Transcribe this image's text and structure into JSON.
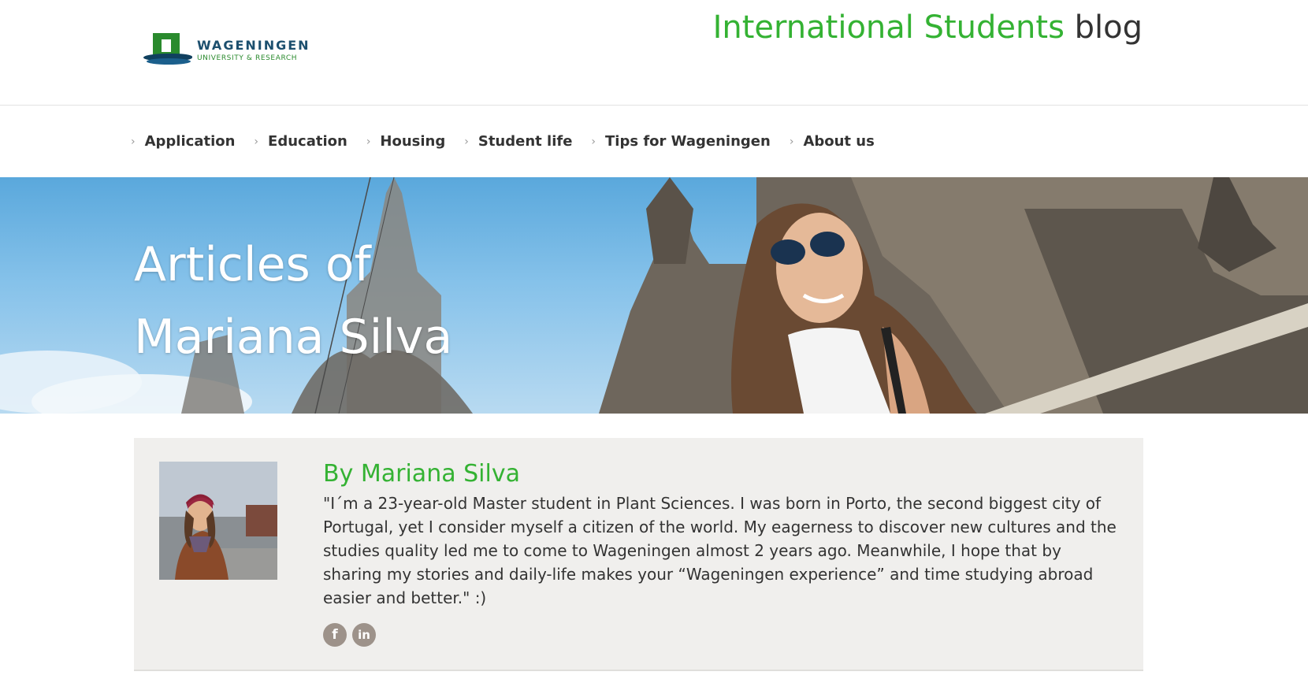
{
  "header": {
    "logo_line1": "WAGENINGEN",
    "logo_line2": "UNIVERSITY & RESEARCH",
    "title_green": "International Students",
    "title_dark": "blog"
  },
  "nav": {
    "items": [
      {
        "label": "Application"
      },
      {
        "label": "Education"
      },
      {
        "label": "Housing"
      },
      {
        "label": "Student life"
      },
      {
        "label": "Tips for Wageningen"
      },
      {
        "label": "About us"
      }
    ],
    "chevron": "›"
  },
  "hero": {
    "title_line1": "Articles of",
    "title_line2": "Mariana Silva"
  },
  "author": {
    "name": "By Mariana Silva",
    "bio": "\"I´m a 23-year-old Master student in Plant Sciences. I was born in Porto, the second biggest city of Portugal, yet I consider myself a citizen of the world. My eagerness to discover new cultures and the studies quality led me to come to Wageningen almost 2 years ago. Meanwhile, I hope that by sharing my stories and daily-life makes your “Wageningen experience” and time studying abroad easier and better.\" :)",
    "social": [
      {
        "icon": "facebook-icon",
        "glyph": "f"
      },
      {
        "icon": "linkedin-icon",
        "glyph": "in"
      }
    ]
  },
  "colors": {
    "accent_green": "#34b233",
    "social_grey": "#9d928a",
    "card_bg": "#f0efed"
  }
}
